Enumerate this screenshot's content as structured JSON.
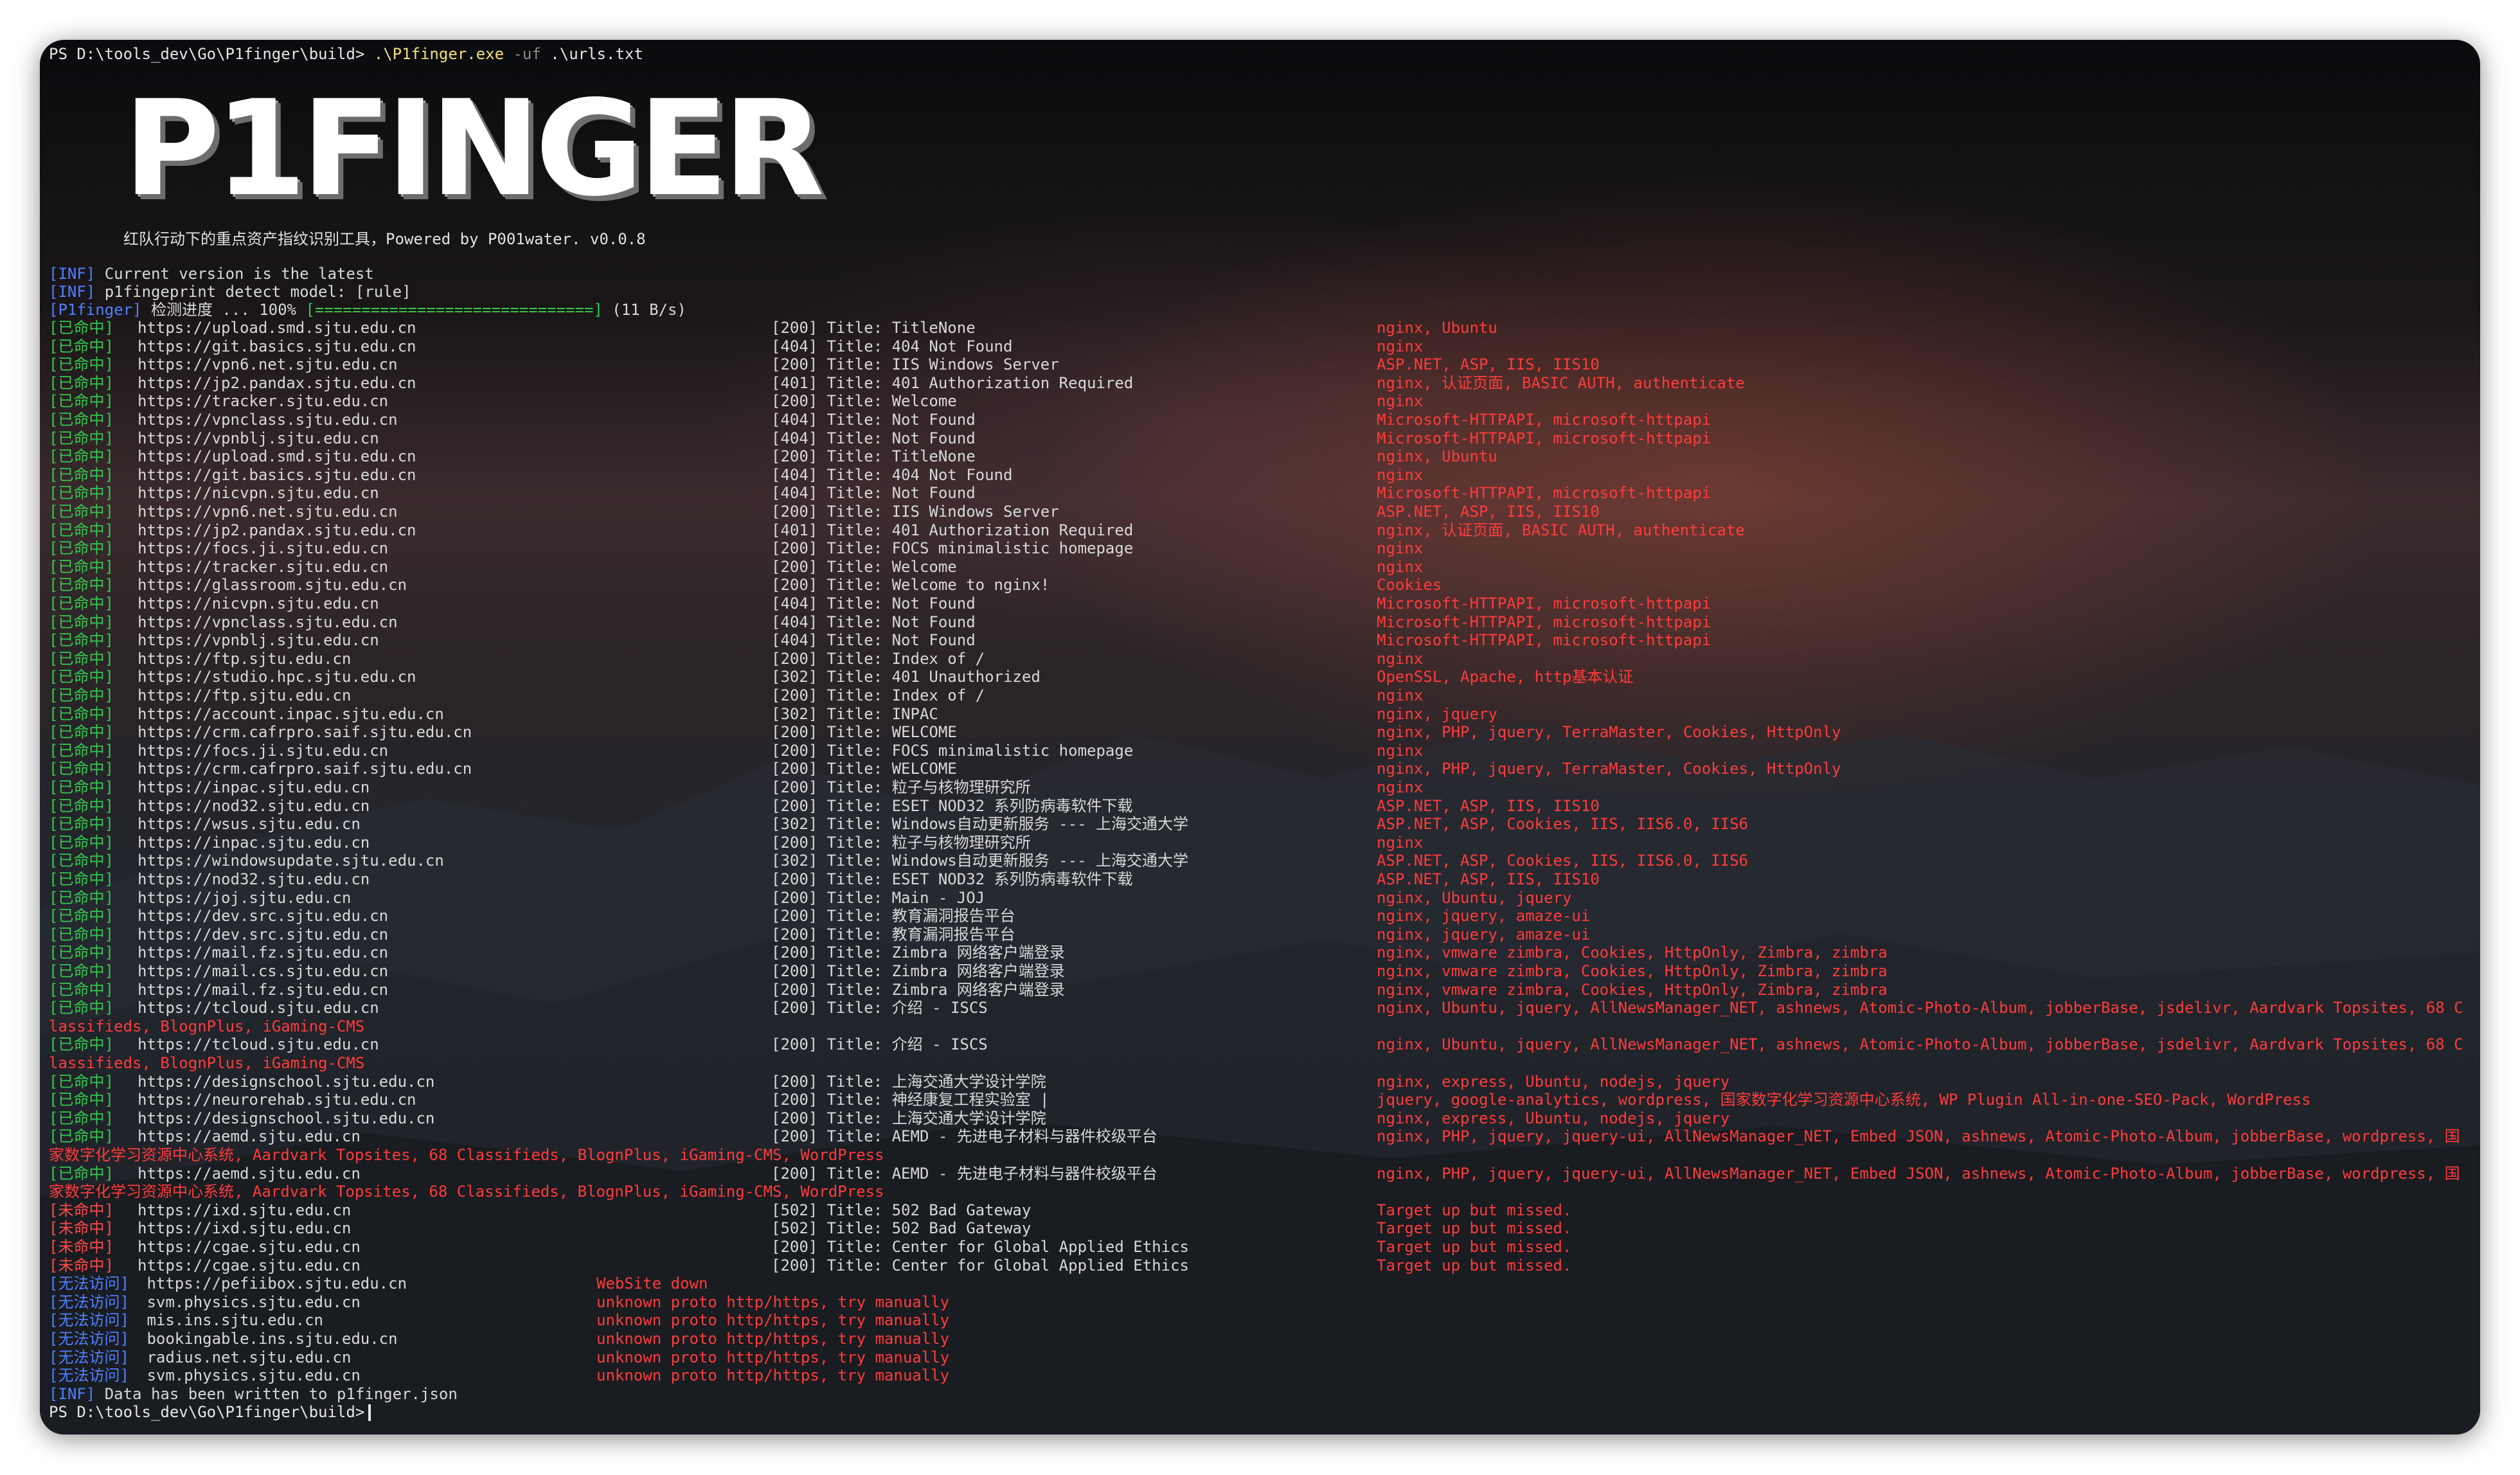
{
  "terminal": {
    "prompt_line": {
      "prompt": "PS D:\\tools_dev\\Go\\P1finger\\build> ",
      "command": ".\\P1finger.exe",
      "arg_flag": "-uf",
      "arg_value": " .\\urls.txt"
    },
    "logo": "P1FINGER",
    "subtitle": "红队行动下的重点资产指纹识别工具，Powered by P001water. v0.0.8",
    "info_lines": [
      {
        "tag": "[INF]",
        "text": " Current version is the latest"
      },
      {
        "tag": "[INF]",
        "text": " p1fingeprint detect model: [rule]"
      }
    ],
    "progress": {
      "tag": "[P1finger]",
      "label": " 检测进度 ... 100% ",
      "bar": "[==============================]",
      "rate": " (11 B/s)"
    },
    "results": [
      {
        "status": "[已命中]",
        "url": "https://upload.smd.sjtu.edu.cn",
        "code": "[200]",
        "title": "Title: TitleNone",
        "fp": "nginx, Ubuntu"
      },
      {
        "status": "[已命中]",
        "url": "https://git.basics.sjtu.edu.cn",
        "code": "[404]",
        "title": "Title: 404 Not Found",
        "fp": "nginx"
      },
      {
        "status": "[已命中]",
        "url": "https://vpn6.net.sjtu.edu.cn",
        "code": "[200]",
        "title": "Title: IIS Windows Server",
        "fp": "ASP.NET, ASP, IIS, IIS10"
      },
      {
        "status": "[已命中]",
        "url": "https://jp2.pandax.sjtu.edu.cn",
        "code": "[401]",
        "title": "Title: 401 Authorization Required",
        "fp": "nginx, 认证页面, BASIC AUTH, authenticate"
      },
      {
        "status": "[已命中]",
        "url": "https://tracker.sjtu.edu.cn",
        "code": "[200]",
        "title": "Title: Welcome",
        "fp": "nginx"
      },
      {
        "status": "[已命中]",
        "url": "https://vpnclass.sjtu.edu.cn",
        "code": "[404]",
        "title": "Title: Not Found",
        "fp": "Microsoft-HTTPAPI, microsoft-httpapi"
      },
      {
        "status": "[已命中]",
        "url": "https://vpnblj.sjtu.edu.cn",
        "code": "[404]",
        "title": "Title: Not Found",
        "fp": "Microsoft-HTTPAPI, microsoft-httpapi"
      },
      {
        "status": "[已命中]",
        "url": "https://upload.smd.sjtu.edu.cn",
        "code": "[200]",
        "title": "Title: TitleNone",
        "fp": "nginx, Ubuntu"
      },
      {
        "status": "[已命中]",
        "url": "https://git.basics.sjtu.edu.cn",
        "code": "[404]",
        "title": "Title: 404 Not Found",
        "fp": "nginx"
      },
      {
        "status": "[已命中]",
        "url": "https://nicvpn.sjtu.edu.cn",
        "code": "[404]",
        "title": "Title: Not Found",
        "fp": "Microsoft-HTTPAPI, microsoft-httpapi"
      },
      {
        "status": "[已命中]",
        "url": "https://vpn6.net.sjtu.edu.cn",
        "code": "[200]",
        "title": "Title: IIS Windows Server",
        "fp": "ASP.NET, ASP, IIS, IIS10"
      },
      {
        "status": "[已命中]",
        "url": "https://jp2.pandax.sjtu.edu.cn",
        "code": "[401]",
        "title": "Title: 401 Authorization Required",
        "fp": "nginx, 认证页面, BASIC AUTH, authenticate"
      },
      {
        "status": "[已命中]",
        "url": "https://focs.ji.sjtu.edu.cn",
        "code": "[200]",
        "title": "Title: FOCS minimalistic homepage",
        "fp": "nginx"
      },
      {
        "status": "[已命中]",
        "url": "https://tracker.sjtu.edu.cn",
        "code": "[200]",
        "title": "Title: Welcome",
        "fp": "nginx"
      },
      {
        "status": "[已命中]",
        "url": "https://glassroom.sjtu.edu.cn",
        "code": "[200]",
        "title": "Title: Welcome to nginx!",
        "fp": "Cookies"
      },
      {
        "status": "[已命中]",
        "url": "https://nicvpn.sjtu.edu.cn",
        "code": "[404]",
        "title": "Title: Not Found",
        "fp": "Microsoft-HTTPAPI, microsoft-httpapi"
      },
      {
        "status": "[已命中]",
        "url": "https://vpnclass.sjtu.edu.cn",
        "code": "[404]",
        "title": "Title: Not Found",
        "fp": "Microsoft-HTTPAPI, microsoft-httpapi"
      },
      {
        "status": "[已命中]",
        "url": "https://vpnblj.sjtu.edu.cn",
        "code": "[404]",
        "title": "Title: Not Found",
        "fp": "Microsoft-HTTPAPI, microsoft-httpapi"
      },
      {
        "status": "[已命中]",
        "url": "https://ftp.sjtu.edu.cn",
        "code": "[200]",
        "title": "Title: Index of /",
        "fp": "nginx"
      },
      {
        "status": "[已命中]",
        "url": "https://studio.hpc.sjtu.edu.cn",
        "code": "[302]",
        "title": "Title: 401 Unauthorized",
        "fp": "OpenSSL, Apache, http基本认证"
      },
      {
        "status": "[已命中]",
        "url": "https://ftp.sjtu.edu.cn",
        "code": "[200]",
        "title": "Title: Index of /",
        "fp": "nginx"
      },
      {
        "status": "[已命中]",
        "url": "https://account.inpac.sjtu.edu.cn",
        "code": "[302]",
        "title": "Title: INPAC",
        "fp": "nginx, jquery"
      },
      {
        "status": "[已命中]",
        "url": "https://crm.cafrpro.saif.sjtu.edu.cn",
        "code": "[200]",
        "title": "Title: WELCOME",
        "fp": "nginx, PHP, jquery, TerraMaster, Cookies, HttpOnly"
      },
      {
        "status": "[已命中]",
        "url": "https://focs.ji.sjtu.edu.cn",
        "code": "[200]",
        "title": "Title: FOCS minimalistic homepage",
        "fp": "nginx"
      },
      {
        "status": "[已命中]",
        "url": "https://crm.cafrpro.saif.sjtu.edu.cn",
        "code": "[200]",
        "title": "Title: WELCOME",
        "fp": "nginx, PHP, jquery, TerraMaster, Cookies, HttpOnly"
      },
      {
        "status": "[已命中]",
        "url": "https://inpac.sjtu.edu.cn",
        "code": "[200]",
        "title": "Title: 粒子与核物理研究所",
        "fp": "nginx"
      },
      {
        "status": "[已命中]",
        "url": "https://nod32.sjtu.edu.cn",
        "code": "[200]",
        "title": "Title: ESET NOD32 系列防病毒软件下载",
        "fp": "ASP.NET, ASP, IIS, IIS10"
      },
      {
        "status": "[已命中]",
        "url": "https://wsus.sjtu.edu.cn",
        "code": "[302]",
        "title": "Title: Windows自动更新服务 --- 上海交通大学",
        "fp": "ASP.NET, ASP, Cookies, IIS, IIS6.0, IIS6"
      },
      {
        "status": "[已命中]",
        "url": "https://inpac.sjtu.edu.cn",
        "code": "[200]",
        "title": "Title: 粒子与核物理研究所",
        "fp": "nginx"
      },
      {
        "status": "[已命中]",
        "url": "https://windowsupdate.sjtu.edu.cn",
        "code": "[302]",
        "title": "Title: Windows自动更新服务 --- 上海交通大学",
        "fp": "ASP.NET, ASP, Cookies, IIS, IIS6.0, IIS6"
      },
      {
        "status": "[已命中]",
        "url": "https://nod32.sjtu.edu.cn",
        "code": "[200]",
        "title": "Title: ESET NOD32 系列防病毒软件下载",
        "fp": "ASP.NET, ASP, IIS, IIS10"
      },
      {
        "status": "[已命中]",
        "url": "https://joj.sjtu.edu.cn",
        "code": "[200]",
        "title": "Title: Main - JOJ",
        "fp": "nginx, Ubuntu, jquery"
      },
      {
        "status": "[已命中]",
        "url": "https://dev.src.sjtu.edu.cn",
        "code": "[200]",
        "title": "Title: 教育漏洞报告平台",
        "fp": "nginx, jquery, amaze-ui"
      },
      {
        "status": "[已命中]",
        "url": "https://dev.src.sjtu.edu.cn",
        "code": "[200]",
        "title": "Title: 教育漏洞报告平台",
        "fp": "nginx, jquery, amaze-ui"
      },
      {
        "status": "[已命中]",
        "url": "https://mail.fz.sjtu.edu.cn",
        "code": "[200]",
        "title": "Title: Zimbra 网络客户端登录",
        "fp": "nginx, vmware zimbra, Cookies, HttpOnly, Zimbra, zimbra"
      },
      {
        "status": "[已命中]",
        "url": "https://mail.cs.sjtu.edu.cn",
        "code": "[200]",
        "title": "Title: Zimbra 网络客户端登录",
        "fp": "nginx, vmware zimbra, Cookies, HttpOnly, Zimbra, zimbra"
      },
      {
        "status": "[已命中]",
        "url": "https://mail.fz.sjtu.edu.cn",
        "code": "[200]",
        "title": "Title: Zimbra 网络客户端登录",
        "fp": "nginx, vmware zimbra, Cookies, HttpOnly, Zimbra, zimbra"
      },
      {
        "status": "[已命中]",
        "url": "https://tcloud.sjtu.edu.cn",
        "code": "[200]",
        "title": "Title: 介绍 - ISCS",
        "fp": "nginx, Ubuntu, jquery, AllNewsManager_NET, ashnews, Atomic-Photo-Album, jobberBase, jsdelivr, Aardvark Topsites, 68 C",
        "wrap": "lassifieds, BlognPlus, iGaming-CMS"
      },
      {
        "status": "[已命中]",
        "url": "https://tcloud.sjtu.edu.cn",
        "code": "[200]",
        "title": "Title: 介绍 - ISCS",
        "fp": "nginx, Ubuntu, jquery, AllNewsManager_NET, ashnews, Atomic-Photo-Album, jobberBase, jsdelivr, Aardvark Topsites, 68 C",
        "wrap": "lassifieds, BlognPlus, iGaming-CMS"
      },
      {
        "status": "[已命中]",
        "url": "https://designschool.sjtu.edu.cn",
        "code": "[200]",
        "title": "Title: 上海交通大学设计学院",
        "fp": "nginx, express, Ubuntu, nodejs, jquery"
      },
      {
        "status": "[已命中]",
        "url": "https://neurorehab.sjtu.edu.cn",
        "code": "[200]",
        "title": "Title: 神经康复工程实验室 |",
        "fp": "jquery, google-analytics, wordpress, 国家数字化学习资源中心系统, WP Plugin All-in-one-SEO-Pack, WordPress"
      },
      {
        "status": "[已命中]",
        "url": "https://designschool.sjtu.edu.cn",
        "code": "[200]",
        "title": "Title: 上海交通大学设计学院",
        "fp": "nginx, express, Ubuntu, nodejs, jquery"
      },
      {
        "status": "[已命中]",
        "url": "https://aemd.sjtu.edu.cn",
        "code": "[200]",
        "title": "Title: AEMD - 先进电子材料与器件校级平台",
        "fp": "nginx, PHP, jquery, jquery-ui, AllNewsManager_NET, Embed JSON, ashnews, Atomic-Photo-Album, jobberBase, wordpress, 国",
        "wrap": "家数字化学习资源中心系统, Aardvark Topsites, 68 Classifieds, BlognPlus, iGaming-CMS, WordPress"
      },
      {
        "status": "[已命中]",
        "url": "https://aemd.sjtu.edu.cn",
        "code": "[200]",
        "title": "Title: AEMD - 先进电子材料与器件校级平台",
        "fp": "nginx, PHP, jquery, jquery-ui, AllNewsManager_NET, Embed JSON, ashnews, Atomic-Photo-Album, jobberBase, wordpress, 国",
        "wrap": "家数字化学习资源中心系统, Aardvark Topsites, 68 Classifieds, BlognPlus, iGaming-CMS, WordPress"
      },
      {
        "status": "[未命中]",
        "url": "https://ixd.sjtu.edu.cn",
        "code": "[502]",
        "title": "Title: 502 Bad Gateway",
        "fp": "Target up but missed."
      },
      {
        "status": "[未命中]",
        "url": "https://ixd.sjtu.edu.cn",
        "code": "[502]",
        "title": "Title: 502 Bad Gateway",
        "fp": "Target up but missed."
      },
      {
        "status": "[未命中]",
        "url": "https://cgae.sjtu.edu.cn",
        "code": "[200]",
        "title": "Title: Center for Global Applied Ethics",
        "fp": "Target up but missed."
      },
      {
        "status": "[未命中]",
        "url": "https://cgae.sjtu.edu.cn",
        "code": "[200]",
        "title": "Title: Center for Global Applied Ethics",
        "fp": "Target up but missed."
      }
    ],
    "unreachable": [
      {
        "status": "[无法访问]",
        "url": " https://pefiibox.sjtu.edu.cn",
        "msg": "WebSite down"
      },
      {
        "status": "[无法访问]",
        "url": " svm.physics.sjtu.edu.cn",
        "msg": "unknown proto http/https, try manually"
      },
      {
        "status": "[无法访问]",
        "url": " mis.ins.sjtu.edu.cn",
        "msg": "unknown proto http/https, try manually"
      },
      {
        "status": "[无法访问]",
        "url": " bookingable.ins.sjtu.edu.cn",
        "msg": "unknown proto http/https, try manually"
      },
      {
        "status": "[无法访问]",
        "url": " radius.net.sjtu.edu.cn",
        "msg": "unknown proto http/https, try manually"
      },
      {
        "status": "[无法访问]",
        "url": " svm.physics.sjtu.edu.cn",
        "msg": "unknown proto http/https, try manually"
      }
    ],
    "final_info": {
      "tag": "[INF]",
      "text": " Data has been written to p1finger.json"
    },
    "final_prompt": "PS D:\\tools_dev\\Go\\P1finger\\build>"
  }
}
